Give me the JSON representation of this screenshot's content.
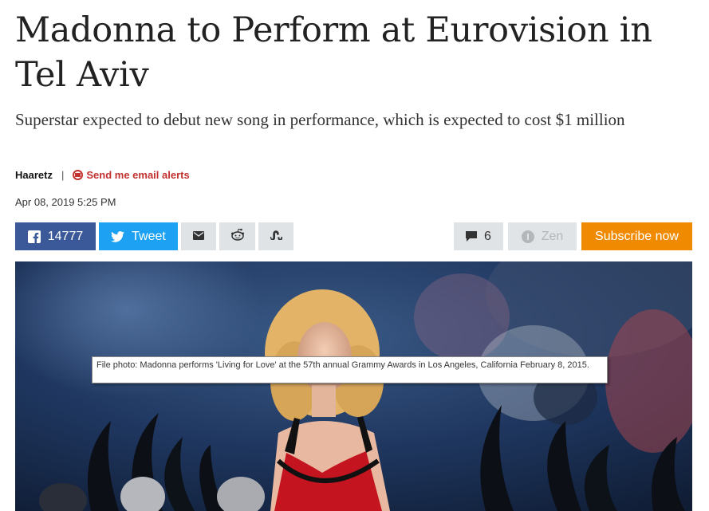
{
  "article": {
    "headline": "Madonna to Perform at Eurovision in Tel Aviv",
    "subheadline": "Superstar expected to debut new song in performance, which is expected to cost $1 million",
    "author": "Haaretz",
    "separator": "|",
    "email_alerts_label": "Send me email alerts",
    "date": "Apr 08, 2019 5:25 PM"
  },
  "share_bar": {
    "facebook_count": "14777",
    "tweet_label": "Tweet",
    "comment_count": "6",
    "zen_label": "Zen",
    "subscribe_label": "Subscribe now",
    "icons": [
      "facebook-icon",
      "twitter-icon",
      "mail-icon",
      "reddit-icon",
      "stumbleupon-icon",
      "comment-icon",
      "zen-icon"
    ]
  },
  "photo": {
    "caption_tooltip": "File photo: Madonna performs 'Living for Love' at the 57th annual Grammy Awards in Los Angeles, California February 8, 2015."
  },
  "colors": {
    "facebook": "#3b5998",
    "twitter": "#1da1f2",
    "subscribe": "#f08a00",
    "alert_red": "#c2322f"
  }
}
